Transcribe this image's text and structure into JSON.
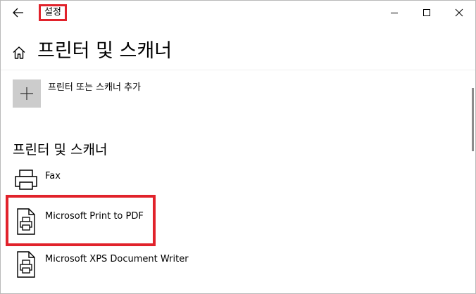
{
  "window": {
    "app_title": "설정",
    "controls": {
      "minimize": "minimize",
      "maximize": "maximize",
      "close": "close"
    }
  },
  "header": {
    "title": "프린터 및 스캐너"
  },
  "add_device": {
    "label": "프린터 또는 스캐너 추가"
  },
  "section": {
    "title": "프린터 및 스캐너"
  },
  "devices": [
    {
      "name": "Fax",
      "icon": "printer-icon"
    },
    {
      "name": "Microsoft Print to PDF",
      "icon": "document-printer-icon"
    },
    {
      "name": "Microsoft XPS Document Writer",
      "icon": "document-printer-icon"
    }
  ],
  "colors": {
    "highlight": "#e1222b",
    "tile": "#cccccc",
    "scrollbar": "#8c8c8c"
  }
}
